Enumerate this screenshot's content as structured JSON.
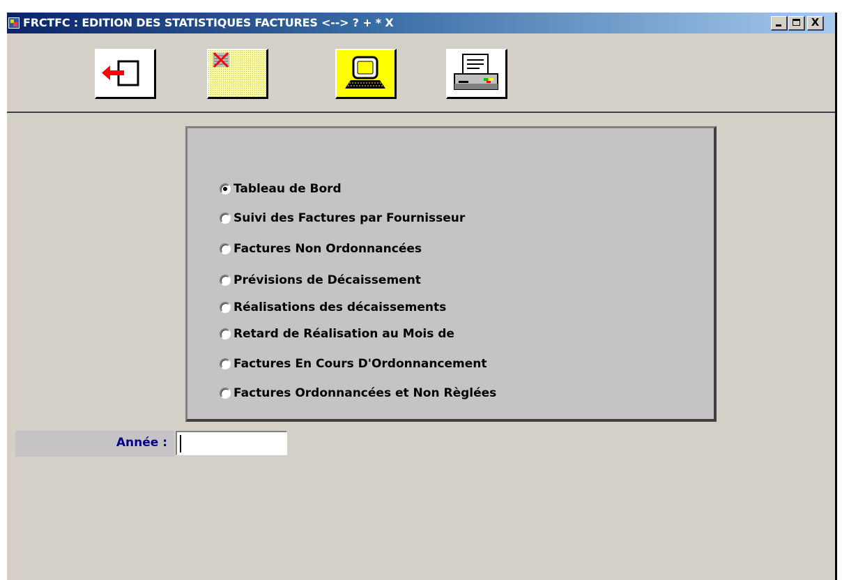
{
  "window": {
    "title": "FRCTFC : EDITION DES STATISTIQUES FACTURES <--> ? + * X",
    "minimize_label": "",
    "maximize_label": "",
    "close_label": "X"
  },
  "toolbar": {
    "buttons": [
      {
        "name": "exit",
        "icon": "exit-arrow-icon"
      },
      {
        "name": "cancel",
        "icon": "cancel-document-icon"
      },
      {
        "name": "preview",
        "icon": "computer-screen-icon"
      },
      {
        "name": "print",
        "icon": "printer-icon"
      }
    ]
  },
  "report_options": {
    "selected_index": 0,
    "items": [
      "Tableau de Bord",
      "Suivi des Factures par Fournisseur",
      "Factures Non Ordonnancées",
      "Prévisions de Décaissement",
      "Réalisations des décaissements",
      "Retard de Réalisation au Mois de",
      "Factures En Cours D'Ordonnancement",
      "Factures Ordonnancées et Non Règlées"
    ]
  },
  "year_field": {
    "label": "Année :",
    "value": ""
  },
  "colors": {
    "window_bg": "#d4d0c8",
    "panel_bg": "#c6c3c6",
    "title_start": "#0a246a",
    "title_end": "#a6caf0",
    "label_blue": "#00008b",
    "cancel_btn_bg": "#ffff99",
    "screen_btn_bg": "#ffff00"
  }
}
